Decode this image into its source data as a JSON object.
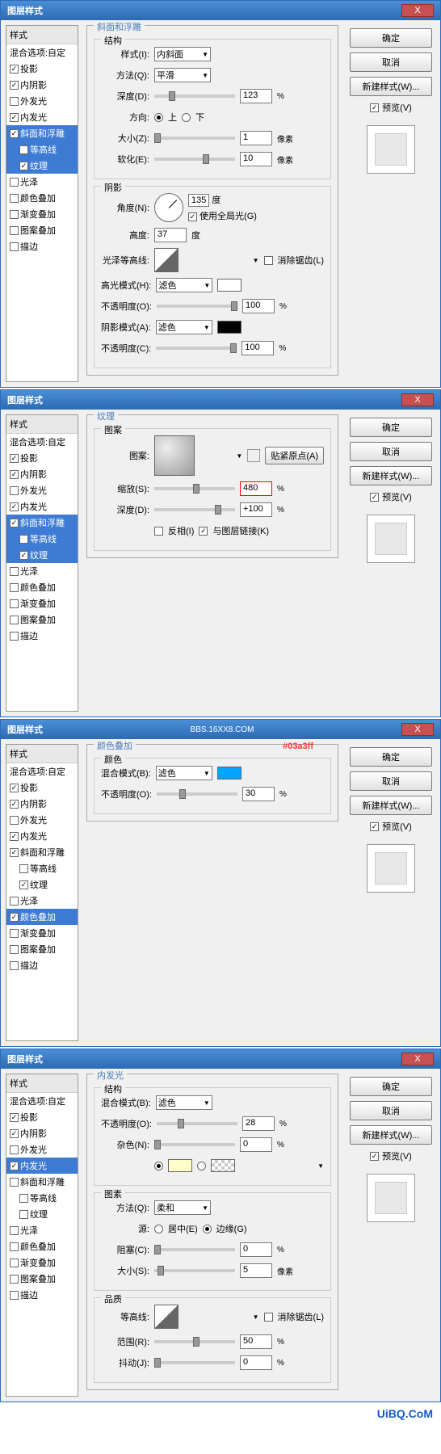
{
  "dialog_title": "图层样式",
  "close_x": "X",
  "styles_header": "样式",
  "blend_options": "混合选项:自定",
  "style_items": {
    "drop_shadow": "投影",
    "inner_shadow": "内阴影",
    "outer_glow": "外发光",
    "inner_glow": "内发光",
    "bevel_emboss": "斜面和浮雕",
    "contour": "等高线",
    "texture": "纹理",
    "satin": "光泽",
    "color_overlay": "颜色叠加",
    "gradient_overlay": "渐变叠加",
    "pattern_overlay": "图案叠加",
    "stroke": "描边"
  },
  "buttons": {
    "ok": "确定",
    "cancel": "取消",
    "new_style": "新建样式(W)...",
    "preview": "预览(V)"
  },
  "panel1": {
    "title": "斜面和浮雕",
    "structure": "结构",
    "style_label": "样式(I):",
    "style_val": "内斜面",
    "method_label": "方法(Q):",
    "method_val": "平滑",
    "depth_label": "深度(D):",
    "depth_val": "123",
    "direction_label": "方向:",
    "dir_up": "上",
    "dir_down": "下",
    "size_label": "大小(Z):",
    "size_val": "1",
    "soften_label": "软化(E):",
    "soften_val": "10",
    "shading": "阴影",
    "angle_label": "角度(N):",
    "angle_val": "135",
    "angle_unit": "度",
    "global_light": "使用全局光(G)",
    "altitude_label": "高度:",
    "altitude_val": "37",
    "gloss_contour": "光泽等高线:",
    "antialias": "消除锯齿(L)",
    "highlight_mode": "高光模式(H):",
    "highlight_val": "滤色",
    "highlight_opacity": "不透明度(O):",
    "highlight_opacity_val": "100",
    "shadow_mode": "阴影模式(A):",
    "shadow_val": "滤色",
    "shadow_opacity": "不透明度(C):",
    "shadow_opacity_val": "100",
    "pixels": "像素",
    "percent": "%"
  },
  "panel2": {
    "title": "纹理",
    "pattern": "图案",
    "pattern_label": "图案:",
    "snap_origin": "贴紧原点(A)",
    "scale_label": "缩放(S):",
    "scale_val": "480",
    "depth_label": "深度(D):",
    "depth_val": "+100",
    "invert": "反相(I)",
    "link_layer": "与图层链接(K)",
    "percent": "%"
  },
  "panel3": {
    "title": "颜色叠加",
    "color": "颜色",
    "blend_mode": "混合模式(B):",
    "blend_val": "滤色",
    "opacity_label": "不透明度(O):",
    "opacity_val": "30",
    "annotation": "#03a3ff",
    "watermark": "BBS.16XX8.COM",
    "percent": "%"
  },
  "panel4": {
    "title": "内发光",
    "structure": "结构",
    "blend_mode": "混合模式(B):",
    "blend_val": "滤色",
    "opacity_label": "不透明度(O):",
    "opacity_val": "28",
    "noise_label": "杂色(N):",
    "noise_val": "0",
    "elements": "图素",
    "method_label": "方法(Q):",
    "method_val": "柔和",
    "source_label": "源:",
    "source_center": "居中(E)",
    "source_edge": "边缘(G)",
    "choke_label": "阻塞(C):",
    "choke_val": "0",
    "size_label": "大小(S):",
    "size_val": "5",
    "quality": "品质",
    "contour_label": "等高线:",
    "antialias": "消除锯齿(L)",
    "range_label": "范围(R):",
    "range_val": "50",
    "jitter_label": "抖动(J):",
    "jitter_val": "0",
    "pixels": "像素",
    "percent": "%"
  },
  "footer": "UiBQ.CoM"
}
